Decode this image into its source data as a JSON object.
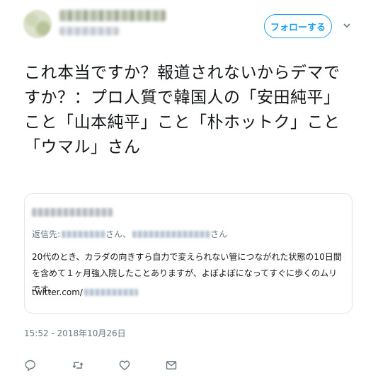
{
  "header": {
    "follow_label": "フォローする",
    "more_icon": "chevron-down-icon"
  },
  "tweet": {
    "text": "これ本当ですか？報道されないからデマですか？：プロ人質で韓国人の「安田純平」こと「山本純平」こと「朴ホットク」こと「ウマル」さん"
  },
  "quoted_tweet": {
    "reply_prefix": "返信先:",
    "reply_sep1": "さん、",
    "reply_sep2": "さん",
    "body": "20代のとき、カラダの向きすら自力で変えられない管につながれた状態の10日間を含めて１ヶ月強入院したことありますが、よぼよぼになってすぐに歩くのムリです。",
    "link_prefix": "twitter.com/"
  },
  "meta": {
    "timestamp": "15:52 - 2018年10月26日"
  },
  "actions": {
    "icons": [
      "reply-icon",
      "retweet-icon",
      "like-icon",
      "message-icon"
    ]
  },
  "colors": {
    "accent": "#1da1f2",
    "secondary_text": "#657786",
    "border": "#e1e8ed"
  }
}
